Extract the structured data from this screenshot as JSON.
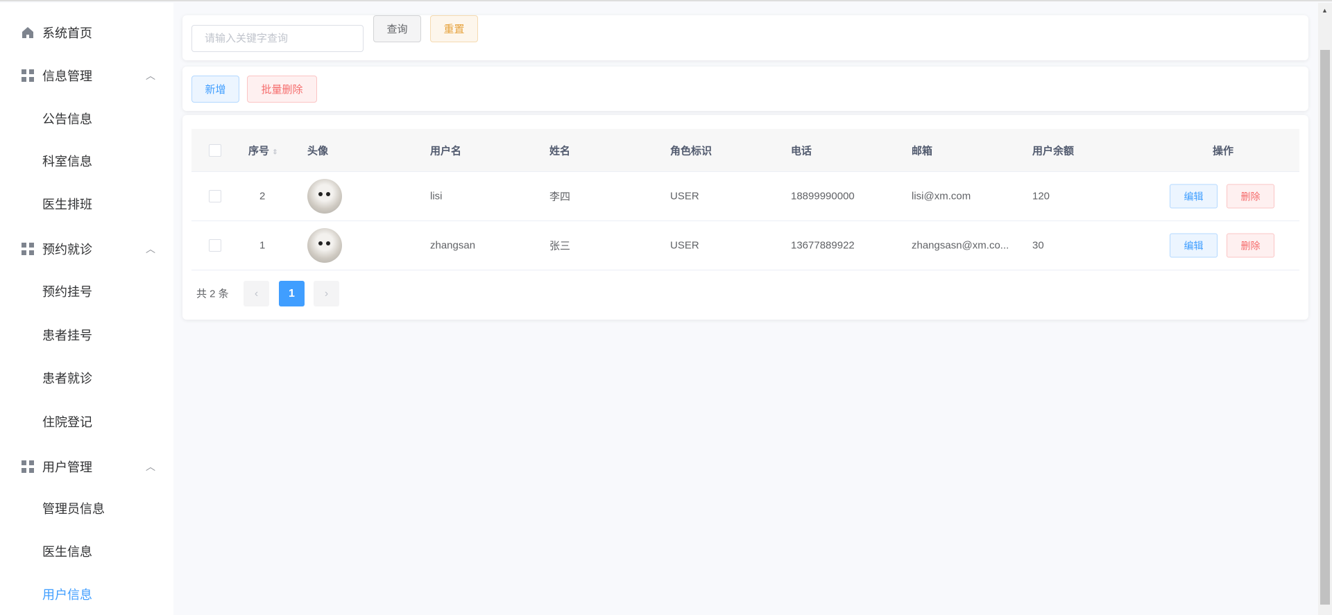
{
  "sidebar": {
    "items": [
      {
        "label": "系统首页",
        "icon": "home-icon"
      },
      {
        "label": "信息管理",
        "icon": "grid-icon",
        "expanded": true
      },
      {
        "label": "公告信息"
      },
      {
        "label": "科室信息"
      },
      {
        "label": "医生排班"
      },
      {
        "label": "预约就诊",
        "icon": "grid-icon",
        "expanded": true
      },
      {
        "label": "预约挂号"
      },
      {
        "label": "患者挂号"
      },
      {
        "label": "患者就诊"
      },
      {
        "label": "住院登记"
      },
      {
        "label": "用户管理",
        "icon": "grid-icon",
        "expanded": true
      },
      {
        "label": "管理员信息"
      },
      {
        "label": "医生信息"
      },
      {
        "label": "用户信息",
        "active": true
      }
    ]
  },
  "search": {
    "placeholder": "请输入关键字查询",
    "value": "",
    "query_label": "查询",
    "reset_label": "重置"
  },
  "actions": {
    "add_label": "新增",
    "batch_delete_label": "批量删除"
  },
  "table": {
    "headers": [
      "序号",
      "头像",
      "用户名",
      "姓名",
      "角色标识",
      "电话",
      "邮箱",
      "用户余额",
      "操作"
    ],
    "rows": [
      {
        "id": "2",
        "username": "lisi",
        "name": "李四",
        "role": "USER",
        "phone": "18899990000",
        "email": "lisi@xm.com",
        "balance": "120"
      },
      {
        "id": "1",
        "username": "zhangsan",
        "name": "张三",
        "role": "USER",
        "phone": "13677889922",
        "email": "zhangsasn@xm.co...",
        "balance": "30"
      }
    ],
    "edit_label": "编辑",
    "delete_label": "删除"
  },
  "pagination": {
    "total_text": "共 2 条",
    "current_page": "1"
  },
  "colors": {
    "primary": "#409eff",
    "danger": "#f56c6c",
    "warning": "#e6a23c"
  }
}
